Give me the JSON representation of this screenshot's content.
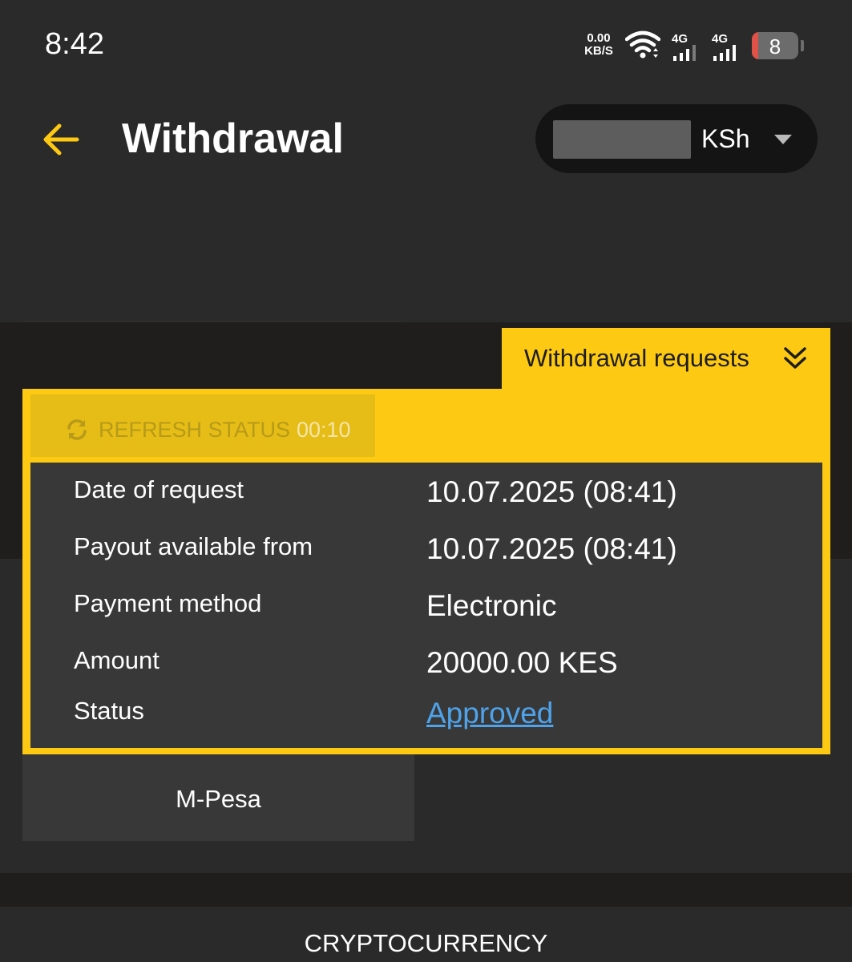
{
  "status_bar": {
    "time": "8:42",
    "net_speed_value": "0.00",
    "net_speed_unit": "KB/S",
    "sim1_label": "4G",
    "sim2_label": "4G",
    "battery_level": "8"
  },
  "header": {
    "title": "Withdrawal",
    "currency": "KSh",
    "back_icon": "arrow-left-icon",
    "dropdown_icon": "caret-down-icon"
  },
  "requests_tab": {
    "label": "Withdrawal requests",
    "icon": "double-chevron-down-icon"
  },
  "refresh": {
    "label": "REFRESH STATUS",
    "timer": "00:10",
    "icon": "refresh-icon"
  },
  "request_details": [
    {
      "label": "Date of request",
      "value": "10.07.2025 (08:41)"
    },
    {
      "label": "Payout available from",
      "value": "10.07.2025 (08:41)"
    },
    {
      "label": "Payment method",
      "value": "Electronic"
    },
    {
      "label": "Amount",
      "value": "20000.00 KES"
    },
    {
      "label": "Status",
      "value": "Approved"
    }
  ],
  "payment_option": {
    "label": "M-Pesa"
  },
  "bottom_section": {
    "label": "CRYPTOCURRENCY"
  },
  "colors": {
    "accent": "#fdc913",
    "background": "#2a2a2a",
    "panel": "#383838",
    "link": "#4ea3ea"
  }
}
